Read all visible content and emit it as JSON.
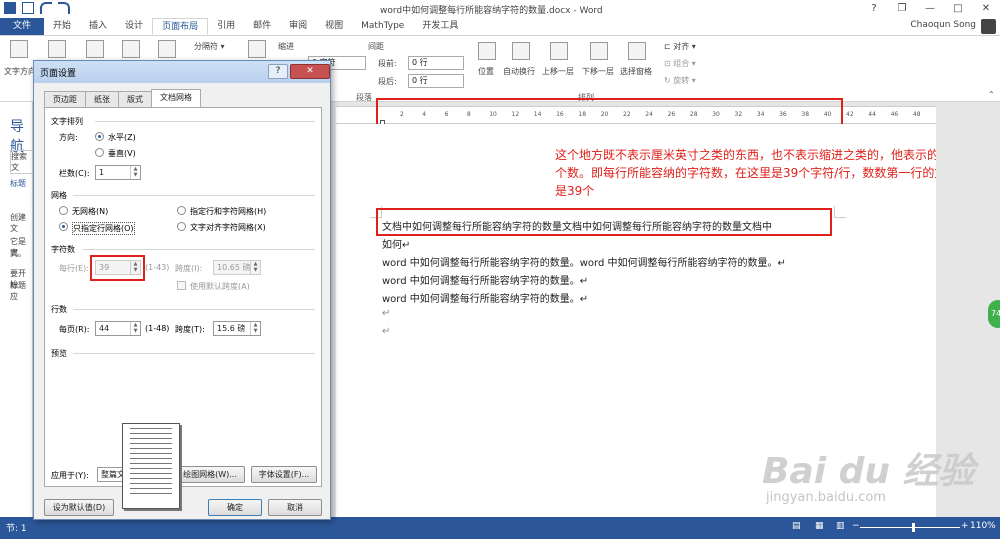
{
  "titlebar": {
    "title": "word中如何调整每行所能容纳字符的数量.docx - Word",
    "help": "?",
    "restore": "❐",
    "min": "—",
    "max": "□",
    "close": "✕"
  },
  "tabs": [
    "文件",
    "开始",
    "插入",
    "设计",
    "页面布局",
    "引用",
    "邮件",
    "审阅",
    "视图",
    "MathType",
    "开发工具"
  ],
  "active_tab": "页面布局",
  "user": "Chaoqun Song",
  "ribbon": {
    "text_direction": "文字方向",
    "separator": "分隔符",
    "indent": "缩进",
    "spacing": "间距",
    "before_label": "段前:",
    "after_label": "段后:",
    "before_value": "0 行",
    "after_value": "0 行",
    "left_value": "0 字符",
    "para_group": "段落",
    "position": "位置",
    "wrap": "自动换行",
    "bring_forward": "上移一层",
    "send_backward": "下移一层",
    "selection_pane": "选择窗格",
    "align": "对齐",
    "group": "组合",
    "rotate": "旋转",
    "arrange_group": "排列"
  },
  "ruler_numbers": [
    "2",
    "4",
    "6",
    "8",
    "10",
    "12",
    "14",
    "16",
    "18",
    "20",
    "22",
    "24",
    "26",
    "28",
    "30",
    "32",
    "34",
    "36",
    "38",
    "40",
    "42",
    "44",
    "46",
    "48"
  ],
  "navpane": {
    "title": "导航",
    "search": "搜索文",
    "headings": "标题",
    "t1": "创建文",
    "t2": "它是离",
    "t3": "式。",
    "t4": "要开始",
    "t5": "标题应"
  },
  "annotation": {
    "part1": "这个地方既不表示厘米英寸之类的东西，也不表示缩进之类的，他表示的是字符的个数。即每行所能容纳的字符数，在这里是",
    "num1": "39",
    "part2": "个字符/行，数数第一行的文字是不是是",
    "num2": "39",
    "part3": "个"
  },
  "doc_lines": [
    "文档中如何调整每行所能容纳字符的数量文档中如何调整每行所能容纳字符的数量文档中",
    "如何↵",
    "word 中如何调整每行所能容纳字符的数量。word 中如何调整每行所能容纳字符的数量。↵",
    "word 中如何调整每行所能容纳字符的数量。↵",
    "word 中如何调整每行所能容纳字符的数量。↵",
    "↵",
    "↵"
  ],
  "watermark": {
    "main": "Bai du 经验",
    "sub": "jingyan.baidu.com"
  },
  "bubble": "74",
  "statusbar": {
    "page": "节: 1",
    "zoom": "110%",
    "minus": "−",
    "plus": "+"
  },
  "dialog": {
    "title": "页面设置",
    "help": "?",
    "close": "✕",
    "tabs": [
      "页边距",
      "纸张",
      "版式",
      "文档网格"
    ],
    "active_tab": "文档网格",
    "text_arrangement": "文字排列",
    "direction_label": "方向:",
    "horizontal": "水平(Z)",
    "vertical": "垂直(V)",
    "columns_label": "栏数(C):",
    "columns_value": "1",
    "grid": "网格",
    "no_grid": "无网格(N)",
    "line_char_grid": "指定行和字符网格(H)",
    "line_grid_only": "只指定行网格(O)",
    "char_align_grid": "文字对齐字符网格(X)",
    "chars": "字符数",
    "per_line_label": "每行(E):",
    "per_line_value": "39",
    "per_line_range": "(1-43)",
    "pitch_label": "跨度(I):",
    "pitch_value": "10.65 磅",
    "default_pitch": "使用默认跨度(A)",
    "lines": "行数",
    "per_page_label": "每页(R):",
    "per_page_value": "44",
    "per_page_range": "(1-48)",
    "line_pitch_label": "跨度(T):",
    "line_pitch_value": "15.6 磅",
    "preview": "预览",
    "apply_label": "应用于(Y):",
    "apply_value": "整篇文档",
    "draw_grid": "绘图网格(W)...",
    "font_settings": "字体设置(F)...",
    "set_default": "设为默认值(D)",
    "ok": "确定",
    "cancel": "取消"
  }
}
